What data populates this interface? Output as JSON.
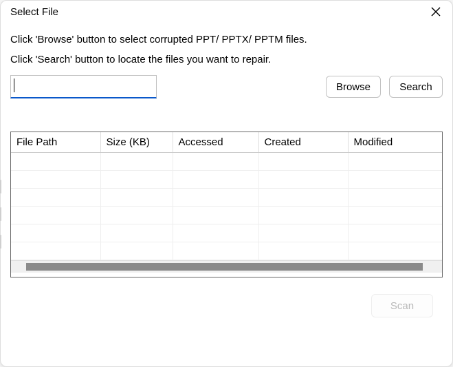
{
  "title": "Select File",
  "line1": "Click 'Browse' button to select corrupted PPT/ PPTX/ PPTM files.",
  "line2": "Click 'Search' button to locate the files you want to repair.",
  "input": {
    "value": "",
    "placeholder": ""
  },
  "buttons": {
    "browse": "Browse",
    "search": "Search",
    "scan": "Scan"
  },
  "table": {
    "columns": [
      "File Path",
      "Size (KB)",
      "Accessed",
      "Created",
      "Modified"
    ],
    "rows": []
  }
}
